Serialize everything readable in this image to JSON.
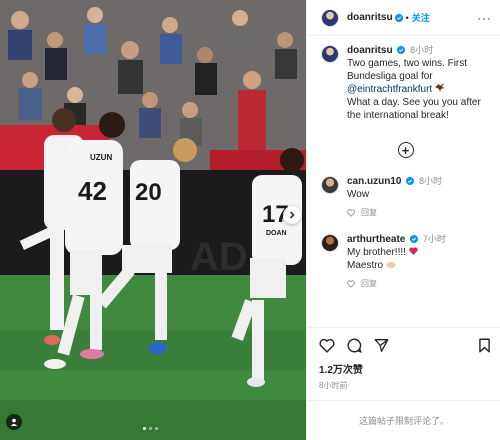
{
  "header": {
    "username": "doanritsu",
    "follow_label": "关注",
    "more_label": "···"
  },
  "caption": {
    "username": "doanritsu",
    "time": "8小时",
    "text_before": "Two games, two wins. First Bundesliga goal for",
    "mention": "@eintrachtfrankfurt",
    "text_after": "What a day. See you you after the international break!",
    "emoji": "eagle"
  },
  "comments": [
    {
      "username": "can.uzun10",
      "time": "8小时",
      "text": "Wow",
      "reply_label": "回复"
    },
    {
      "username": "arthurtheate",
      "time": "7小时",
      "text": "My brother!!!!",
      "text_suffix": "Maestro",
      "reply_label": "回复"
    }
  ],
  "stats": {
    "likes": "1.2万次赞",
    "posted": "8小时前"
  },
  "comment_box": {
    "disabled_text": "这篇帖子限制评论了。"
  },
  "photo": {
    "jersey_numbers": [
      "42",
      "20",
      "17"
    ],
    "jersey_names": [
      "UZUN",
      "DOAN"
    ]
  },
  "colors": {
    "verified": "#0095f6",
    "link": "#00376b",
    "follow": "#0095f6"
  }
}
